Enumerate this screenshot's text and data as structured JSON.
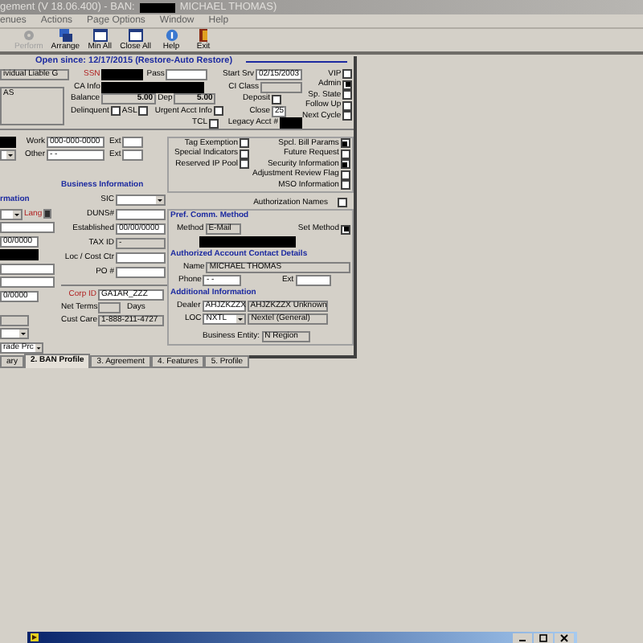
{
  "title_bar": {
    "text_before": "gement (V 18.06.400) - BAN:",
    "text_after": "MICHAEL THOMAS)"
  },
  "menu": [
    "enues",
    "Actions",
    "Page Options",
    "Window",
    "Help"
  ],
  "toolbar": [
    {
      "label": "Perform",
      "disabled": true,
      "kind": "gear"
    },
    {
      "label": "Arrange",
      "disabled": false,
      "kind": "windows"
    },
    {
      "label": "Min All",
      "disabled": false,
      "kind": "window"
    },
    {
      "label": "Close All",
      "disabled": false,
      "kind": "window"
    },
    {
      "label": "Help",
      "disabled": false,
      "kind": "help"
    },
    {
      "label": "Exit",
      "disabled": false,
      "kind": "exit"
    }
  ],
  "header": "Open since: 12/17/2015 (Restore-Auto Restore)",
  "account_type": "ividual Liable G",
  "status_text": "AS",
  "ssn_label": "SSN",
  "pass_label": "Pass",
  "ca_info_label": "CA Info",
  "balance": {
    "label": "Balance",
    "value": "5.00"
  },
  "dep": {
    "label": "Dep",
    "value": "5.00"
  },
  "checks_left": [
    {
      "label": "Delinquent",
      "checked": false
    },
    {
      "label": "ASL",
      "checked": false
    }
  ],
  "urgent": {
    "label": "Urgent Acct Info",
    "checked": false
  },
  "tcl": {
    "label": "TCL",
    "checked": false
  },
  "start_srv": {
    "label": "Start Srv",
    "value": "02/15/2003"
  },
  "ci_class": {
    "label": "CI Class"
  },
  "deposit": {
    "label": "Deposit",
    "checked": false
  },
  "close": {
    "label": "Close",
    "value": "25"
  },
  "legacy_label": "Legacy Acct #",
  "flags": [
    {
      "label": "VIP",
      "checked": false
    },
    {
      "label": "Admin",
      "checked": true
    },
    {
      "label": "Sp. State",
      "checked": false
    },
    {
      "label": "Follow Up",
      "checked": false
    },
    {
      "label": "Next Cycle",
      "checked": false
    }
  ],
  "phones": [
    {
      "label": "Work",
      "value": "000-000-0000",
      "ext": "Ext"
    },
    {
      "label": "Other",
      "value": "-  -",
      "ext": "Ext"
    }
  ],
  "indicators": [
    {
      "label": "Tag Exemption",
      "checked": false
    },
    {
      "label": "Special Indicators",
      "checked": false
    },
    {
      "label": "Reserved IP Pool",
      "checked": false
    }
  ],
  "params": [
    {
      "label": "Spcl. Bill Params",
      "checked": true
    },
    {
      "label": "Future Request",
      "checked": false
    },
    {
      "label": "Security Information",
      "checked": true
    },
    {
      "label": "Adjustment Review Flag",
      "checked": false
    },
    {
      "label": "MSO Information",
      "checked": false
    }
  ],
  "authorization": {
    "label": "Authorization Names",
    "checked": false
  },
  "left_info": {
    "header": "rmation",
    "lang": "Lang",
    "fields": [
      "00/0000",
      "0/0000"
    ]
  },
  "business": {
    "header": "Business Information",
    "rows": [
      {
        "label": "SIC",
        "kind": "dropdown"
      },
      {
        "label": "DUNS#",
        "kind": "field"
      },
      {
        "label": "Established",
        "kind": "field",
        "value": "00/00/0000"
      },
      {
        "label": "TAX ID",
        "kind": "readonly",
        "value": "-"
      },
      {
        "label": "Loc / Cost Ctr",
        "kind": "field"
      },
      {
        "label": "PO #",
        "kind": "field"
      }
    ]
  },
  "pref_comm": {
    "header": "Pref. Comm. Method",
    "method_label": "Method",
    "method": "E-Mail",
    "set_label": "Set Method",
    "set_checked": true
  },
  "contact": {
    "header": "Authorized Account Contact Details",
    "name_label": "Name",
    "name": "MICHAEL THOMAS",
    "phone_label": "Phone",
    "phone": "-  -",
    "ext_label": "Ext"
  },
  "additional": {
    "header": "Additional Information",
    "dealer_label": "Dealer",
    "dealer": "AHJZKZZX",
    "dealer_name": "AHJZKZZX Unknown",
    "loc_label": "LOC",
    "loc": "NXTL",
    "loc_name": "Nextel (General)"
  },
  "business_entity": {
    "label": "Business Entity:",
    "value": "N Region"
  },
  "price_plan": "rade Prc",
  "corp": {
    "label": "Corp ID",
    "value": "GA1AR_ZZZ"
  },
  "net_terms": {
    "label": "Net Terms",
    "unit": "Days"
  },
  "cust_care": {
    "label": "Cust Care",
    "value": "1-888-211-4727"
  },
  "tabs": [
    {
      "label": "ary",
      "selected": false
    },
    {
      "label": "2. BAN Profile",
      "selected": true
    },
    {
      "label": "3. Agreement",
      "selected": false
    },
    {
      "label": "4. Features",
      "selected": false
    },
    {
      "label": "5. Profile",
      "selected": false
    }
  ]
}
